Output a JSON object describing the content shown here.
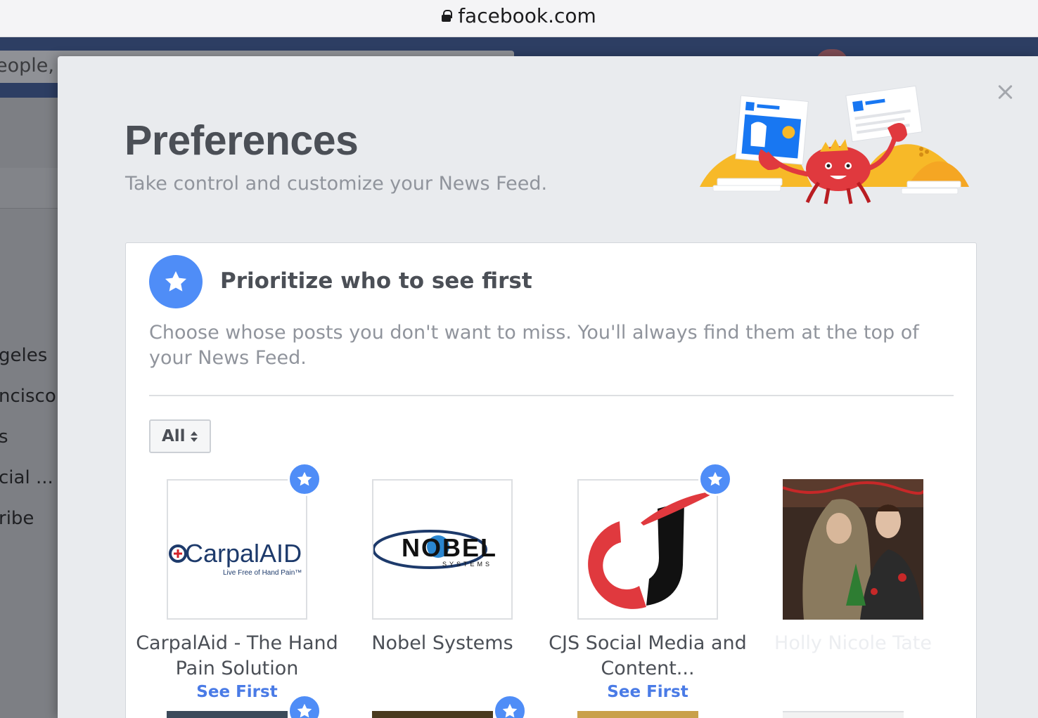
{
  "browser": {
    "url": "facebook.com"
  },
  "background": {
    "search_placeholder": "eople,",
    "sidebar_items": [
      "geles",
      "ncisco",
      "s",
      "cial ...",
      "ribe"
    ]
  },
  "modal": {
    "title": "Preferences",
    "subtitle": "Take control and customize your News Feed."
  },
  "section": {
    "title": "Prioritize who to see first",
    "description": "Choose whose posts you don't want to miss. You'll always find them at the top of your News Feed.",
    "filter_label": "All"
  },
  "pages": [
    {
      "name": "CarpalAid - The Hand Pain Solution",
      "logo_text": "CarpalAID",
      "logo_sub": "Live Free of Hand Pain™",
      "see_first": "See First",
      "starred": true
    },
    {
      "name": "Nobel Systems",
      "logo_text": "NOBEL",
      "logo_sub": "SYSTEMS",
      "starred": false
    },
    {
      "name": "CJS Social Media and Content...",
      "see_first": "See First",
      "starred": true
    },
    {
      "name": "Holly Nicole Tate",
      "starred": false
    }
  ],
  "colors": {
    "accent": "#4f8df7",
    "link": "#4a7be6",
    "title": "#4b4f56",
    "muted": "#90949c"
  }
}
